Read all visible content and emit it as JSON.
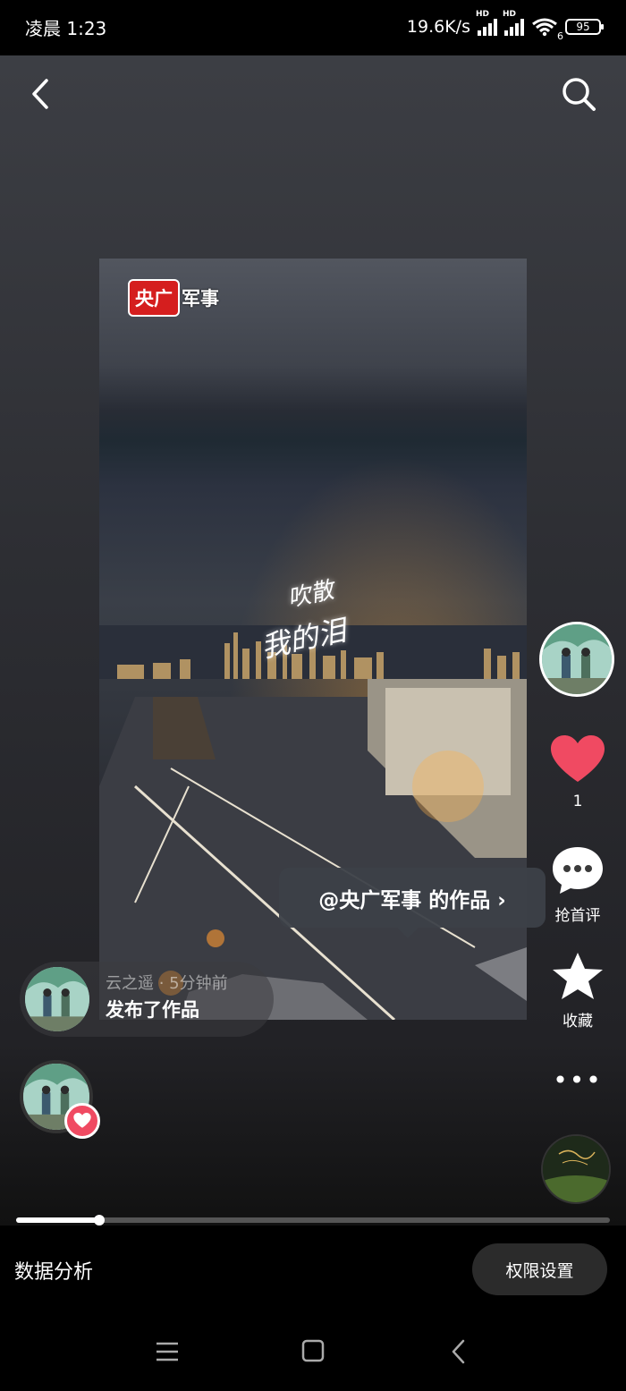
{
  "status_bar": {
    "time": "凌晨 1:23",
    "net_speed": "19.6K/s",
    "signal1_label": "HD",
    "signal2_label": "HD",
    "wifi_label": "6",
    "battery": "95"
  },
  "nav": {
    "back_icon": "chevron-left-icon",
    "search_icon": "search-icon"
  },
  "video": {
    "logo_red": "央广",
    "logo_text": "军事",
    "lyric_line1": "吹散",
    "lyric_line2": "我的泪"
  },
  "tooltip": {
    "text": "@央广军事 的作品 ›"
  },
  "rail": {
    "like_count": "1",
    "comment_label": "抢首评",
    "favorite_label": "收藏",
    "more_label": "•••"
  },
  "notification": {
    "meta": "云之遥 · 5分钟前",
    "action": "发布了作品"
  },
  "progress": {
    "value": 0.14
  },
  "bottom": {
    "analysis_label": "数据分析",
    "permission_label": "权限设置"
  },
  "colors": {
    "like_red": "#f04a62",
    "logo_red": "#d51e1e"
  }
}
